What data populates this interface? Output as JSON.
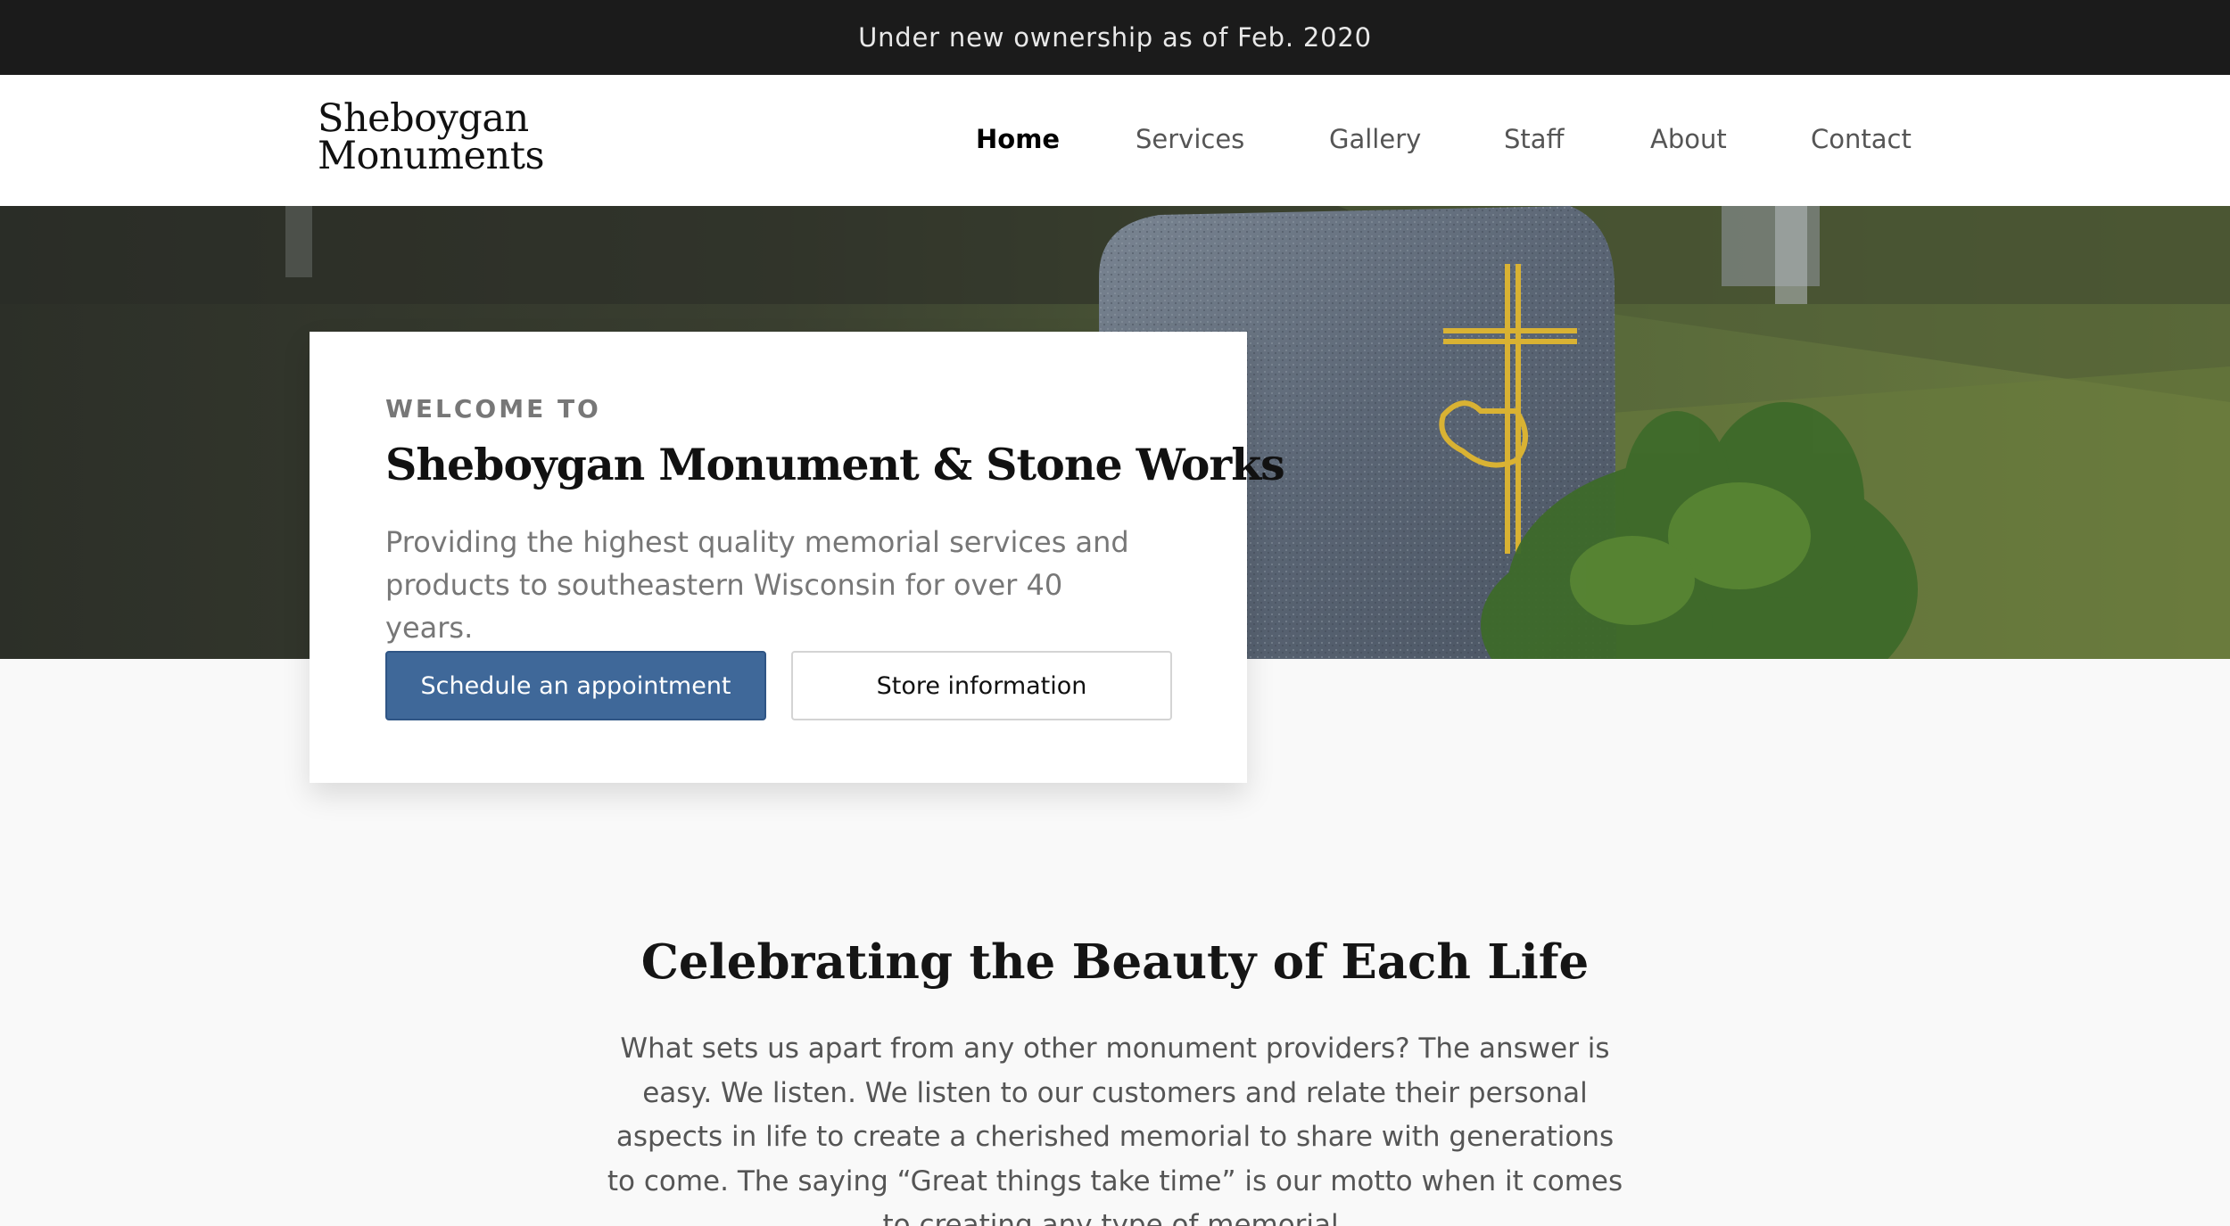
{
  "announcement": "Under new ownership as of Feb. 2020",
  "brand": {
    "line1": "Sheboygan",
    "line2": "Monuments"
  },
  "nav": {
    "items": [
      {
        "label": "Home",
        "active": true
      },
      {
        "label": "Services",
        "active": false
      },
      {
        "label": "Gallery",
        "active": false
      },
      {
        "label": "Staff",
        "active": false
      },
      {
        "label": "About",
        "active": false
      },
      {
        "label": "Contact",
        "active": false
      }
    ]
  },
  "hero": {
    "eyebrow": "WELCOME TO",
    "title": "Sheboygan Monument & Stone Works",
    "description": "Providing the highest quality memorial services and products to southeastern Wisconsin for over 40 years.",
    "primary_button": "Schedule an appointment",
    "secondary_button": "Store information",
    "image_icon": "headstone-cross-praying-hands-photo"
  },
  "section": {
    "title": "Celebrating the Beauty of Each Life",
    "body": "What sets us apart from any other monument providers? The answer is easy. We listen. We listen to our customers and relate their personal aspects in life to create a cherished memorial to share with generations to come. The saying “Great things take time” is our motto when it comes to creating any type of memorial."
  },
  "colors": {
    "announcement_bg": "#1b1b1b",
    "primary": "#3f6899",
    "cross_gold": "#d9b233"
  }
}
